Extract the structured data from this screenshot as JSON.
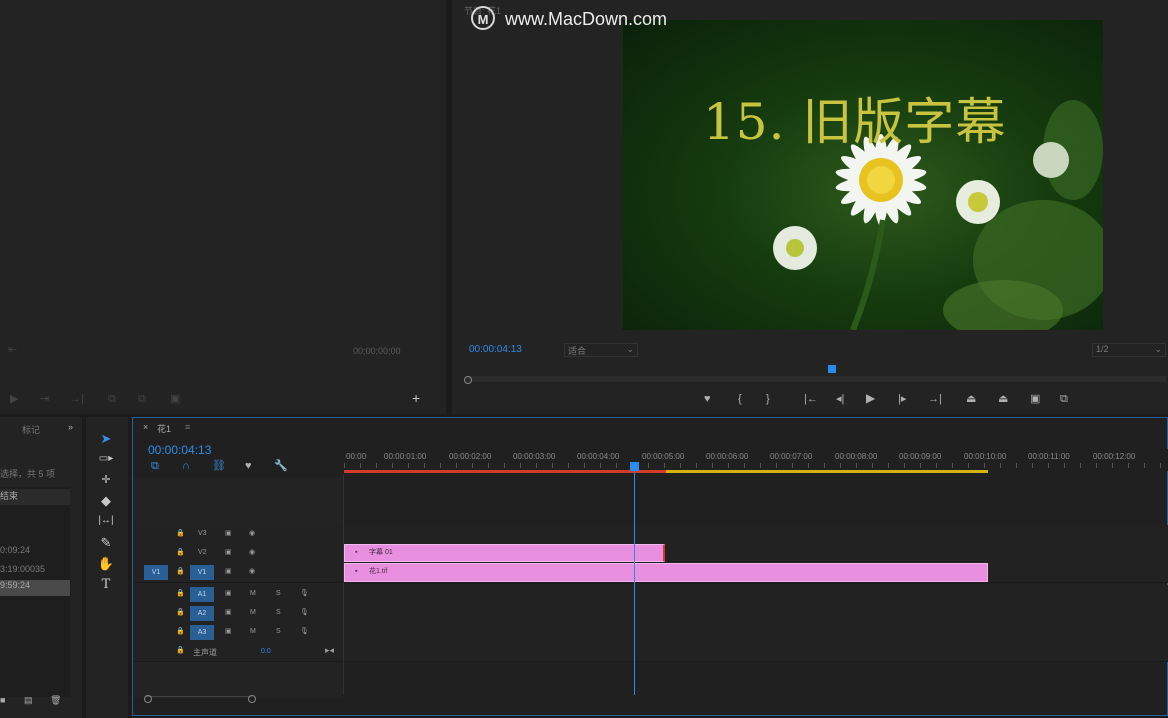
{
  "watermark": {
    "text": "www.MacDown.com"
  },
  "source_monitor": {
    "timecode": "00;00;00;00"
  },
  "program_monitor": {
    "title": "节目: 花1",
    "timecode": "00:00:04:13",
    "fit_select": "适合",
    "resolution_select": "1/2",
    "overlay_title": "15. 旧版字幕"
  },
  "project_panel": {
    "tab_label": "标记",
    "selection_info": "选择，共 5 项",
    "rows": [
      "结束",
      "0:09:24",
      "3:19:00035",
      "9:59:24"
    ]
  },
  "timeline": {
    "tab_label": "花1",
    "timecode": "00:00:04:13",
    "ruler": [
      "00:00",
      "00:00:01:00",
      "00:00:02:00",
      "00:00:03:00",
      "00:00:04:00",
      "00:00:05:00",
      "00:00:06:00",
      "00:00:07:00",
      "00:00:08:00",
      "00:00:09:00",
      "00:00:10:00",
      "00:00:11:00",
      "00:00:12:00"
    ],
    "tracks": {
      "v3": "V3",
      "v2": "V2",
      "v1": "V1",
      "v1_src": "V1",
      "a1": "A1",
      "a2": "A2",
      "a3": "A3",
      "m": "M",
      "s": "S",
      "master": "主声道",
      "master_value": "0.0"
    },
    "clips": {
      "title_clip": "字幕 01",
      "video_clip": "花1.tif"
    }
  },
  "colors": {
    "accent": "#2d8ceb",
    "clip": "#e88fe0",
    "work_area": "#d6b20f",
    "in_out": "#d23a2a"
  }
}
